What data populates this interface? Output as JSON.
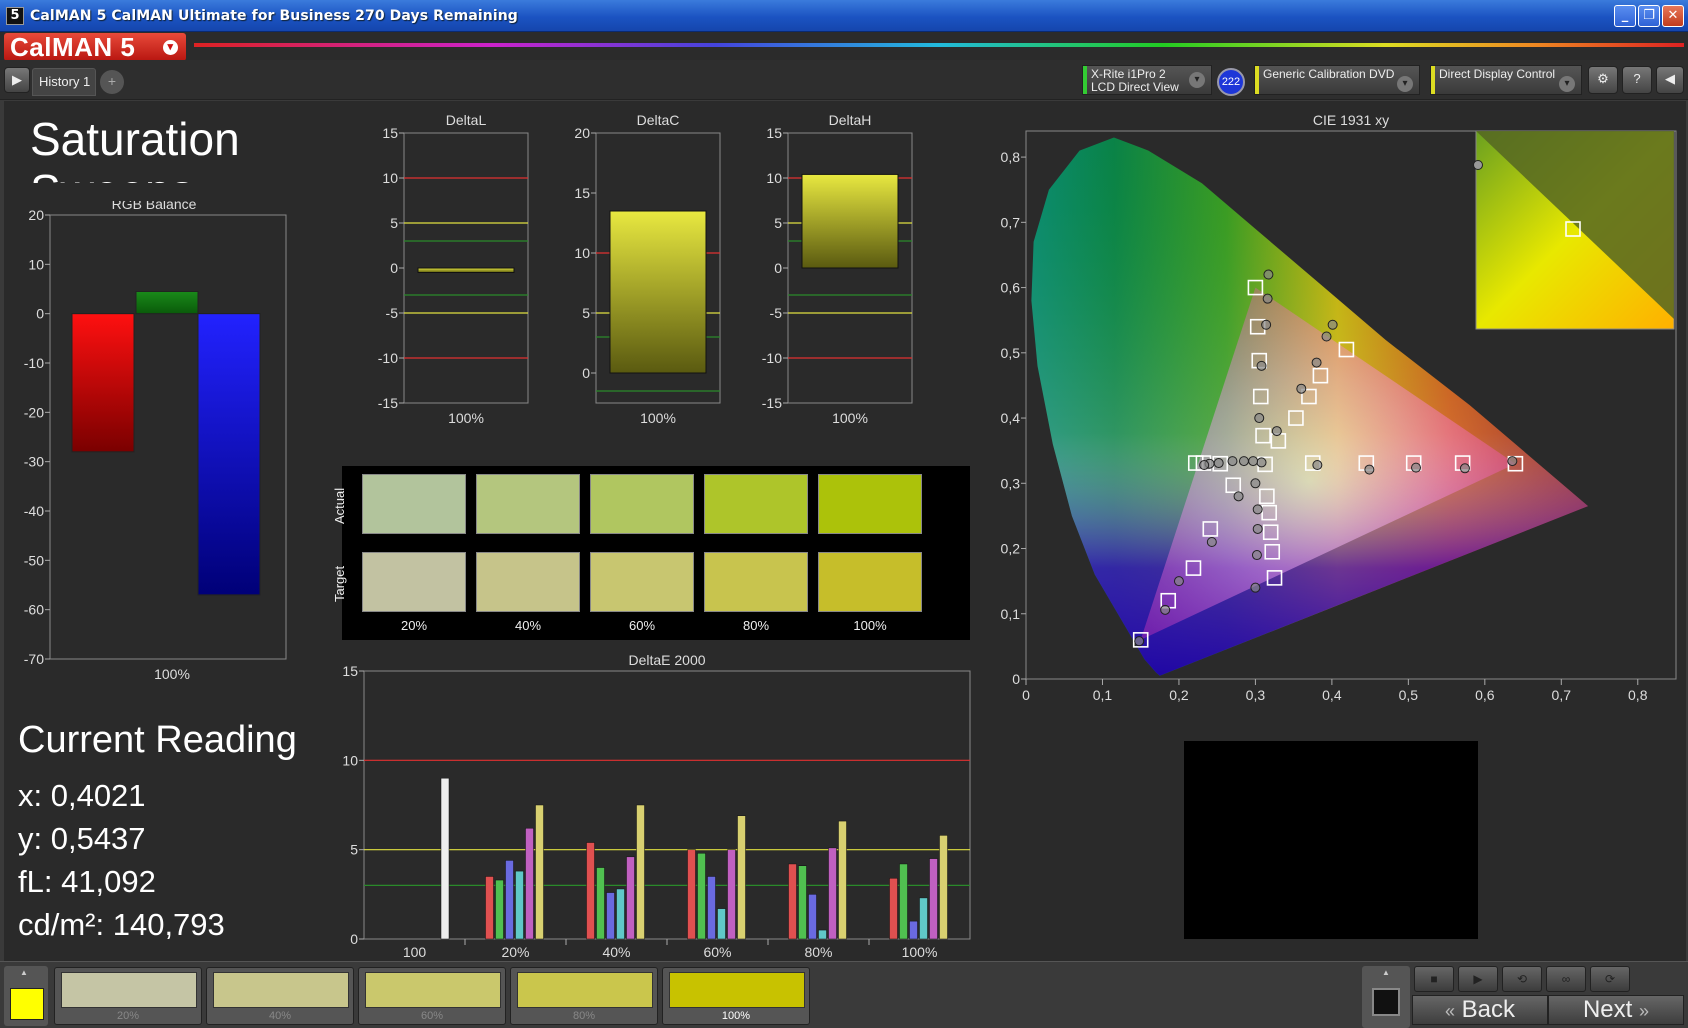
{
  "window": {
    "icon_text": "5",
    "title": "CalMAN 5 CalMAN Ultimate for Business 270 Days Remaining",
    "minimize": "_",
    "restore": "❐",
    "close": "✕"
  },
  "brand": {
    "name": "CalMAN 5",
    "menu_glyph": "▾"
  },
  "toolbar": {
    "play_glyph": "▶",
    "tab_label": "History 1",
    "add_tab_glyph": "+",
    "meter_line1": "X-Rite i1Pro 2",
    "meter_line2": "LCD Direct View",
    "meter_count": "222",
    "source": "Generic Calibration DVD",
    "display": "Direct Display Control",
    "dropdown_glyph": "▾",
    "settings_glyph": "⚙",
    "help_glyph": "?",
    "collapse_glyph": "◀",
    "colors": {
      "meter": "#33cc33",
      "source": "#dddd22",
      "display": "#dddd22"
    }
  },
  "page_title": "Saturation Sweeps",
  "current_reading": {
    "heading": "Current Reading",
    "x": "x: 0,4021",
    "y": "y: 0,5437",
    "fl": "fL: 41,092",
    "cdm2": "cd/m²: 140,793"
  },
  "swatches": {
    "actual_label": "Actual",
    "target_label": "Target",
    "labels": [
      "20%",
      "40%",
      "60%",
      "80%",
      "100%"
    ],
    "actual_colors": [
      "#b2c49c",
      "#b4c67e",
      "#b0c660",
      "#aec52a",
      "#acc20a"
    ],
    "target_colors": [
      "#c2c2a2",
      "#c6c48a",
      "#c8c670",
      "#c8c44e",
      "#c6be2a"
    ]
  },
  "bottom": {
    "swatch_color": "#ffff00",
    "tabs": [
      {
        "label": "20%",
        "color": "#c5c5a5"
      },
      {
        "label": "40%",
        "color": "#c8c68c"
      },
      {
        "label": "60%",
        "color": "#cac86c"
      },
      {
        "label": "80%",
        "color": "#cac64c"
      },
      {
        "label": "100%",
        "color": "#c8c200"
      }
    ],
    "back": "Back",
    "next": "Next",
    "back_glyph": "«",
    "next_glyph": "»"
  },
  "chart_data": [
    {
      "type": "bar",
      "title": "RGB Balance",
      "categories": [
        "100%"
      ],
      "series": [
        {
          "name": "R",
          "color": "#ff0000",
          "values": [
            -28
          ]
        },
        {
          "name": "G",
          "color": "#008800",
          "values": [
            4.5
          ]
        },
        {
          "name": "B",
          "color": "#0000ff",
          "values": [
            -57
          ]
        }
      ],
      "ylim": [
        -70,
        20
      ],
      "yticks": [
        "20",
        "10",
        "0",
        "-10",
        "-20",
        "-30",
        "-40",
        "-50",
        "-60",
        "-70"
      ],
      "grid": false
    },
    {
      "type": "bar",
      "title": "DeltaL",
      "categories": [
        "100%"
      ],
      "values": [
        -0.5
      ],
      "ylim": [
        -15,
        15
      ],
      "yticks": [
        "15",
        "10",
        "5",
        "0",
        "-5",
        "-10",
        "-15"
      ]
    },
    {
      "type": "bar",
      "title": "DeltaC",
      "categories": [
        "100%"
      ],
      "values": [
        13.5
      ],
      "ylim": [
        -2.5,
        20
      ],
      "yticks": [
        "20",
        "15",
        "10",
        "5",
        "0"
      ]
    },
    {
      "type": "bar",
      "title": "DeltaH",
      "categories": [
        "100%"
      ],
      "values": [
        10.4
      ],
      "ylim": [
        -15,
        15
      ],
      "yticks": [
        "15",
        "10",
        "5",
        "0",
        "-5",
        "-10",
        "-15"
      ]
    },
    {
      "type": "bar",
      "title": "DeltaE 2000",
      "categories": [
        "100",
        "20%",
        "40%",
        "60%",
        "80%",
        "100%"
      ],
      "series": [
        {
          "name": "W",
          "color": "#eeeeee",
          "values": [
            9,
            null,
            null,
            null,
            null,
            null
          ]
        },
        {
          "name": "R",
          "color": "#e05050",
          "values": [
            null,
            3.5,
            5.4,
            5.0,
            4.2,
            3.4
          ]
        },
        {
          "name": "G",
          "color": "#50c050",
          "values": [
            null,
            3.3,
            4.0,
            4.8,
            4.1,
            4.2
          ]
        },
        {
          "name": "B",
          "color": "#6a6ae0",
          "values": [
            null,
            4.4,
            2.6,
            3.5,
            2.5,
            1.0
          ]
        },
        {
          "name": "C",
          "color": "#60c8c8",
          "values": [
            null,
            3.8,
            2.8,
            1.7,
            0.5,
            2.3
          ]
        },
        {
          "name": "M",
          "color": "#c060c0",
          "values": [
            null,
            6.2,
            4.6,
            5.0,
            5.1,
            4.5
          ]
        },
        {
          "name": "Y",
          "color": "#d8d070",
          "values": [
            null,
            7.5,
            7.5,
            6.9,
            6.6,
            5.8
          ]
        }
      ],
      "ylim": [
        0,
        15
      ],
      "yticks": [
        "15",
        "10",
        "5",
        "0"
      ]
    },
    {
      "type": "scatter",
      "title": "CIE 1931 xy",
      "xlim": [
        0,
        0.85
      ],
      "ylim": [
        0,
        0.84
      ],
      "xticks": [
        "0",
        "0,1",
        "0,2",
        "0,3",
        "0,4",
        "0,5",
        "0,6",
        "0,7",
        "0,8"
      ],
      "yticks": [
        "0",
        "0,1",
        "0,2",
        "0,3",
        "0,4",
        "0,5",
        "0,6",
        "0,7",
        "0,8"
      ],
      "gamut_triangle": [
        [
          0.64,
          0.33
        ],
        [
          0.3,
          0.6
        ],
        [
          0.15,
          0.06
        ]
      ],
      "targets": [
        [
          0.3127,
          0.329
        ],
        [
          0.375,
          0.331
        ],
        [
          0.445,
          0.331
        ],
        [
          0.507,
          0.331
        ],
        [
          0.571,
          0.331
        ],
        [
          0.64,
          0.33
        ],
        [
          0.31,
          0.373
        ],
        [
          0.307,
          0.433
        ],
        [
          0.305,
          0.488
        ],
        [
          0.303,
          0.54
        ],
        [
          0.3,
          0.6
        ],
        [
          0.271,
          0.297
        ],
        [
          0.241,
          0.23
        ],
        [
          0.219,
          0.17
        ],
        [
          0.186,
          0.12
        ],
        [
          0.15,
          0.06
        ],
        [
          0.33,
          0.365
        ],
        [
          0.353,
          0.4
        ],
        [
          0.37,
          0.433
        ],
        [
          0.385,
          0.465
        ],
        [
          0.419,
          0.505
        ],
        [
          0.254,
          0.33
        ],
        [
          0.232,
          0.331
        ],
        [
          0.222,
          0.331
        ],
        [
          0.315,
          0.28
        ],
        [
          0.318,
          0.255
        ],
        [
          0.32,
          0.225
        ],
        [
          0.322,
          0.195
        ],
        [
          0.325,
          0.155
        ]
      ],
      "measured": [
        [
          0.308,
          0.332
        ],
        [
          0.381,
          0.328
        ],
        [
          0.449,
          0.321
        ],
        [
          0.51,
          0.324
        ],
        [
          0.574,
          0.323
        ],
        [
          0.636,
          0.334
        ],
        [
          0.305,
          0.4
        ],
        [
          0.308,
          0.48
        ],
        [
          0.314,
          0.543
        ],
        [
          0.316,
          0.583
        ],
        [
          0.317,
          0.62
        ],
        [
          0.278,
          0.28
        ],
        [
          0.243,
          0.21
        ],
        [
          0.2,
          0.15
        ],
        [
          0.182,
          0.106
        ],
        [
          0.148,
          0.058
        ],
        [
          0.328,
          0.38
        ],
        [
          0.36,
          0.445
        ],
        [
          0.38,
          0.485
        ],
        [
          0.393,
          0.525
        ],
        [
          0.401,
          0.543
        ],
        [
          0.297,
          0.334
        ],
        [
          0.285,
          0.334
        ],
        [
          0.27,
          0.334
        ],
        [
          0.252,
          0.331
        ],
        [
          0.24,
          0.33
        ],
        [
          0.233,
          0.328
        ],
        [
          0.3,
          0.3
        ],
        [
          0.303,
          0.26
        ],
        [
          0.303,
          0.23
        ],
        [
          0.302,
          0.19
        ],
        [
          0.3,
          0.14
        ]
      ]
    }
  ]
}
